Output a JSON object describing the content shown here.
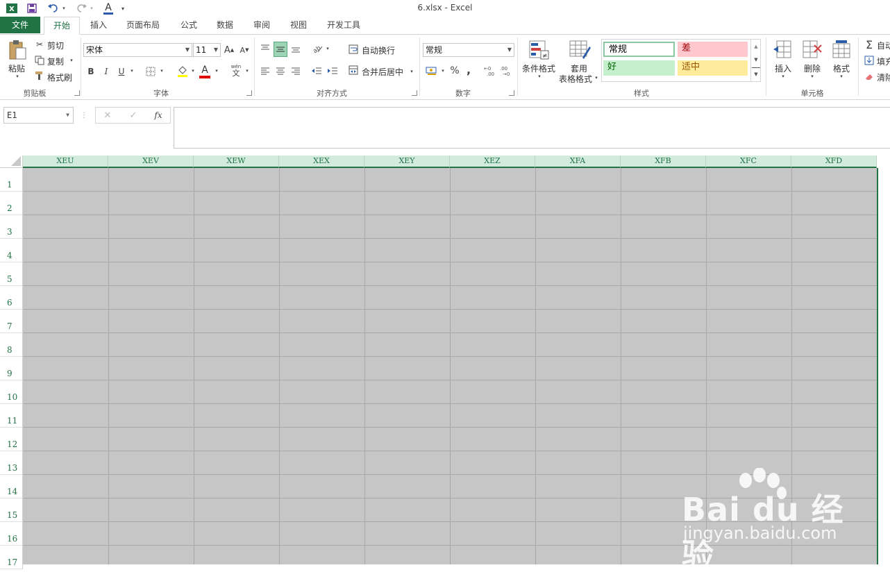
{
  "window": {
    "title": "6.xlsx - Excel"
  },
  "quick_access": {
    "excel_logo": "X",
    "font_color_letter": "A"
  },
  "tabs": [
    {
      "label": "文件"
    },
    {
      "label": "开始"
    },
    {
      "label": "插入"
    },
    {
      "label": "页面布局"
    },
    {
      "label": "公式"
    },
    {
      "label": "数据"
    },
    {
      "label": "审阅"
    },
    {
      "label": "视图"
    },
    {
      "label": "开发工具"
    }
  ],
  "ribbon": {
    "clipboard": {
      "paste": "粘贴",
      "cut": "剪切",
      "copy": "复制",
      "format_painter": "格式刷",
      "label": "剪贴板"
    },
    "font": {
      "name": "宋体",
      "size": "11",
      "bold": "B",
      "italic": "I",
      "underline": "U",
      "grow": "A",
      "shrink": "A",
      "font_color_letter": "A",
      "wen": "wén",
      "wen_char": "文",
      "label": "字体"
    },
    "alignment": {
      "wrap_text": "自动换行",
      "merge_center": "合并后居中",
      "label": "对齐方式"
    },
    "number": {
      "format": "常规",
      "percent": "%",
      "comma": ",",
      "label": "数字"
    },
    "styles": {
      "conditional": "条件格式",
      "table_format_1": "套用",
      "table_format_2": "表格格式",
      "normal": "常规",
      "bad": "差",
      "good": "好",
      "neutral": "适中",
      "label": "样式"
    },
    "cells": {
      "insert": "插入",
      "delete": "删除",
      "format": "格式",
      "label": "单元格"
    },
    "editing": {
      "autosum": "自动",
      "fill": "填充",
      "clear": "清除"
    }
  },
  "formula_bar": {
    "name_box": "E1",
    "cancel": "✕",
    "enter": "✓",
    "fx": "fx",
    "value": ""
  },
  "sheet": {
    "columns": [
      "XEU",
      "XEV",
      "XEW",
      "XEX",
      "XEY",
      "XEZ",
      "XFA",
      "XFB",
      "XFC",
      "XFD"
    ],
    "rows": [
      "1",
      "2",
      "3",
      "4",
      "5",
      "6",
      "7",
      "8",
      "9",
      "10",
      "11",
      "12",
      "13",
      "14",
      "15",
      "16",
      "17"
    ]
  },
  "watermark": {
    "brand": "Bai du 经验",
    "url": "jingyan.baidu.com"
  },
  "colors": {
    "accent": "#217346",
    "selection_fill": "#c6c6c6",
    "col_header_selected": "#d2ebdd",
    "style_bad": "#ffc7ce",
    "style_good": "#c6efce",
    "style_neutral": "#ffeb9c"
  }
}
